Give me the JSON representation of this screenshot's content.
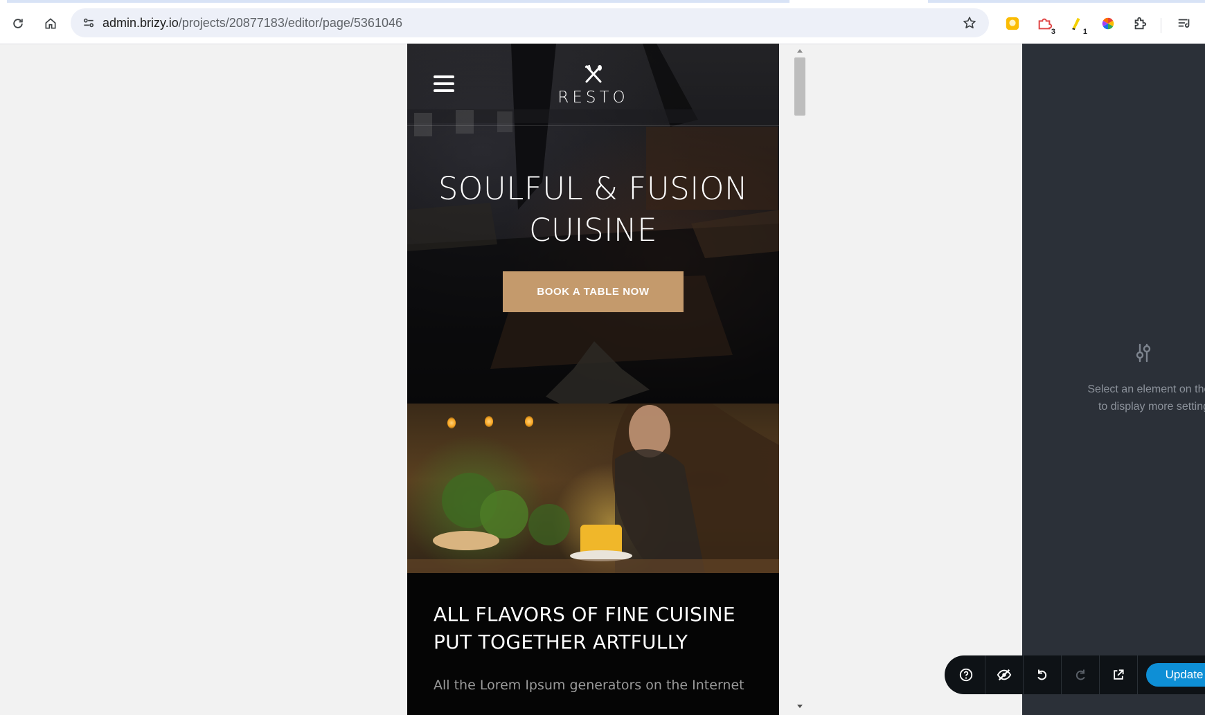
{
  "browser": {
    "url_host": "admin.brizy.io",
    "url_path": "/projects/20877183/editor/page/5361046",
    "extensions": [
      {
        "name": "yellow-extension-icon",
        "badge": ""
      },
      {
        "name": "red-puzzle-extension-icon",
        "badge": "3"
      },
      {
        "name": "highlighter-extension-icon",
        "badge": "1"
      },
      {
        "name": "color-wheel-extension-icon",
        "badge": ""
      }
    ]
  },
  "preview": {
    "logo_text": "RESTO",
    "hero_title_line1": "SOULFUL & FUSION",
    "hero_title_line2": "CUISINE",
    "book_button": "BOOK A TABLE NOW",
    "section_heading_line1": "ALL FLAVORS OF FINE CUISINE",
    "section_heading_line2": "PUT TOGETHER ARTFULLY",
    "section_text": "All the Lorem Ipsum generators on the Internet"
  },
  "side_panel": {
    "message_line1": "Select an element on the pa",
    "message_line2": "to display more settings"
  },
  "bottom_bar": {
    "update_label": "Update"
  },
  "colors": {
    "accent_button": "#c49a6c",
    "update_blue": "#0e8fd6",
    "panel_dark": "#2b3038"
  }
}
